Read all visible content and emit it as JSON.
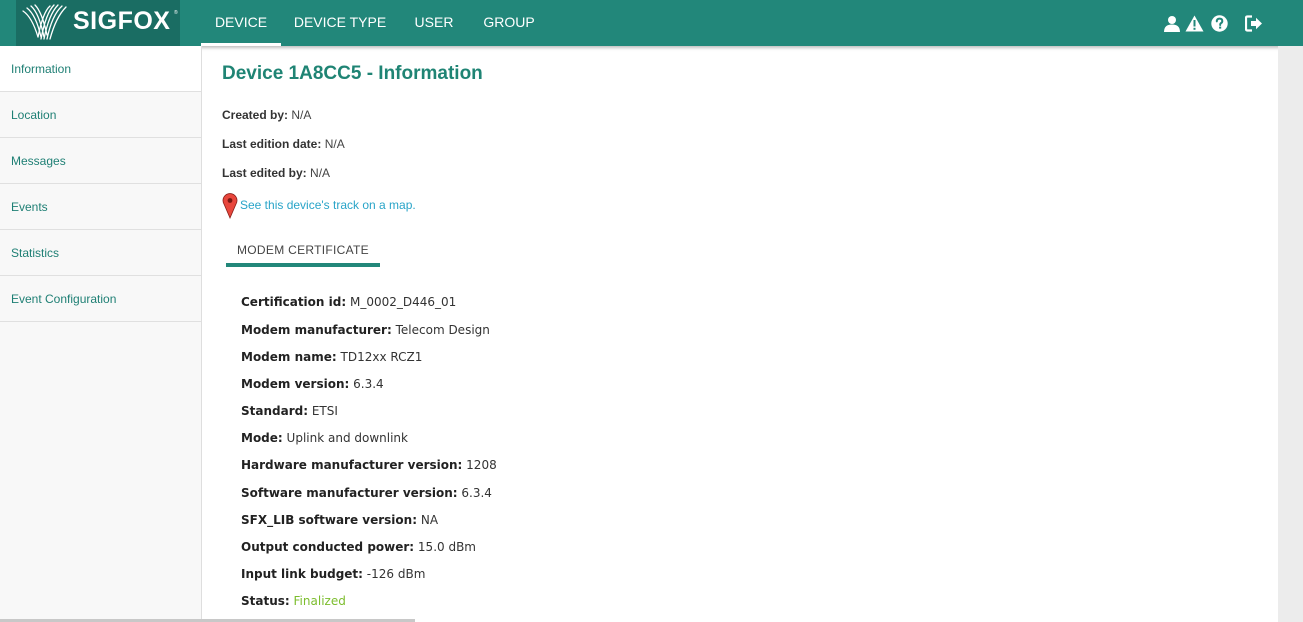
{
  "header": {
    "logo_text": "SIGFOX",
    "logo_tm": "®",
    "tabs": [
      {
        "label": "DEVICE",
        "active": true
      },
      {
        "label": "DEVICE TYPE",
        "active": false
      },
      {
        "label": "USER",
        "active": false
      },
      {
        "label": "GROUP",
        "active": false
      }
    ],
    "icons": [
      "user-icon",
      "warning-icon",
      "help-icon",
      "logout-icon"
    ],
    "bar_color": "#22877a"
  },
  "sidebar": {
    "items": [
      {
        "label": "Information",
        "active": true
      },
      {
        "label": "Location"
      },
      {
        "label": "Messages"
      },
      {
        "label": "Events"
      },
      {
        "label": "Statistics"
      },
      {
        "label": "Event Configuration"
      }
    ]
  },
  "main": {
    "title": "Device 1A8CC5 - Information",
    "meta": [
      {
        "key": "Created by:",
        "value": "N/A"
      },
      {
        "key": "Last edition date:",
        "value": "N/A"
      },
      {
        "key": "Last edited by:",
        "value": "N/A"
      }
    ],
    "map_link": "See this device's track on a map.",
    "tab": "MODEM CERTIFICATE",
    "certificate": [
      {
        "key": "Certification id:",
        "value": "M_0002_D446_01"
      },
      {
        "key": "Modem manufacturer:",
        "value": "Telecom Design"
      },
      {
        "key": "Modem name:",
        "value": "TD12xx RCZ1"
      },
      {
        "key": "Modem version:",
        "value": "6.3.4"
      },
      {
        "key": "Standard:",
        "value": "ETSI"
      },
      {
        "key": "Mode:",
        "value": "Uplink and downlink"
      },
      {
        "key": "Hardware manufacturer version:",
        "value": "1208"
      },
      {
        "key": "Software manufacturer version:",
        "value": "6.3.4"
      },
      {
        "key": "SFX_LIB software version:",
        "value": "NA"
      },
      {
        "key": "Output conducted power:",
        "value": "15.0 dBm"
      },
      {
        "key": "Input link budget:",
        "value": "-126 dBm"
      },
      {
        "key": "Status:",
        "value": "Finalized"
      }
    ]
  }
}
